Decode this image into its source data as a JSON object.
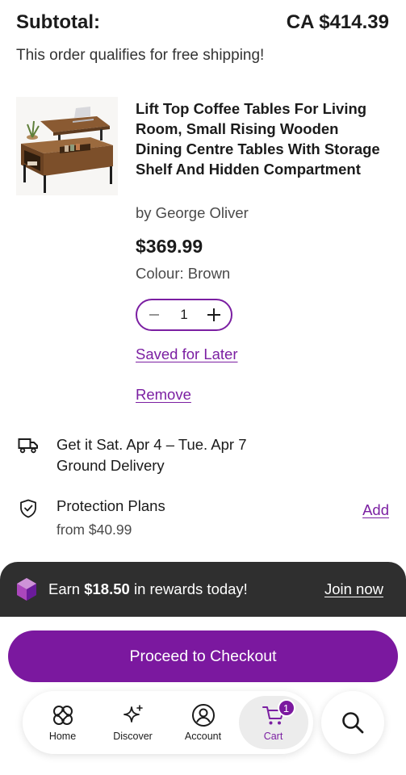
{
  "summary": {
    "subtotal_label": "Subtotal:",
    "subtotal_amount": "CA $414.39",
    "shipping_note": "This order qualifies for free shipping!"
  },
  "item": {
    "title": "Lift Top Coffee Tables For Living Room, Small Rising Wooden Dining Centre Tables With Storage Shelf And Hidden Compartment",
    "brand": "by George Oliver",
    "price": "$369.99",
    "colour": "Colour: Brown",
    "quantity": "1",
    "saved_for_later": "Saved for Later",
    "remove": "Remove"
  },
  "delivery": {
    "line1": "Get it Sat. Apr 4 – Tue. Apr 7",
    "line2": "Ground Delivery"
  },
  "protection": {
    "title": "Protection Plans",
    "price": "from $40.99",
    "add": "Add"
  },
  "rewards": {
    "prefix": "Earn ",
    "amount": "$18.50",
    "suffix": " in rewards today!",
    "join": "Join now"
  },
  "checkout": {
    "label": "Proceed to Checkout"
  },
  "nav": {
    "home": "Home",
    "discover": "Discover",
    "account": "Account",
    "cart": "Cart",
    "cart_count": "1"
  },
  "colors": {
    "accent": "#7b189f",
    "banner": "#2f2f2f"
  },
  "icons": [
    "truck-icon",
    "shield-check-icon",
    "gem-icon",
    "home-icon",
    "sparkle-icon",
    "account-icon",
    "cart-icon",
    "search-icon",
    "minus-icon",
    "plus-icon"
  ]
}
